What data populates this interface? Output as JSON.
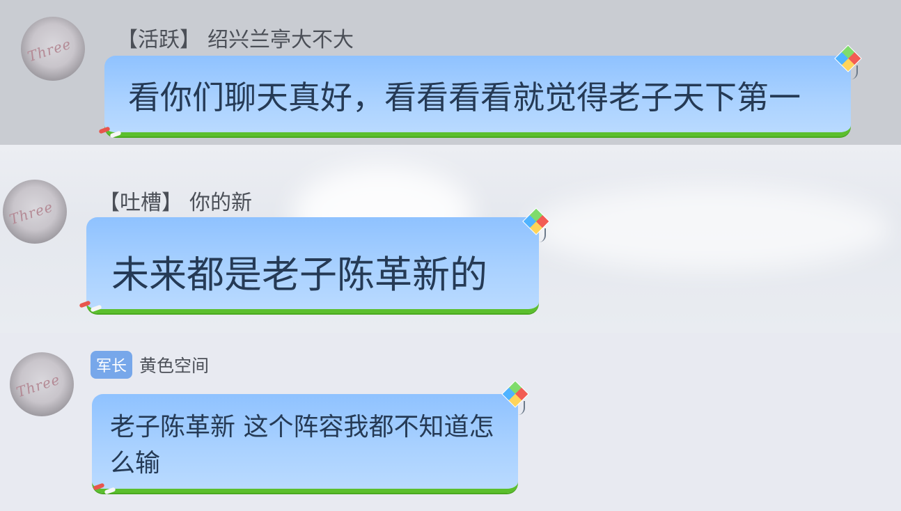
{
  "messages": [
    {
      "badge": "【活跃】",
      "name": "绍兴兰亭大不大",
      "text": "看你们聊天真好，看看看看就觉得老子天下第一",
      "avatar_text": "Three"
    },
    {
      "badge": "【吐槽】",
      "name": "你的新",
      "text": "未来都是老子陈革新的",
      "avatar_text": "Three"
    },
    {
      "badge": "军长",
      "name": "黄色空间",
      "text": "老子陈革新 这个阵容我都不知道怎么输",
      "avatar_text": "Three"
    }
  ],
  "colors": {
    "bubble_top": "#8fc2ff",
    "bubble_bottom": "#b9daff",
    "bubble_border": "#5bbf2d",
    "badge_bg": "#77a7ea",
    "text": "#253a55"
  },
  "icons": [
    "kite-icon",
    "tail-decoration-icon"
  ]
}
